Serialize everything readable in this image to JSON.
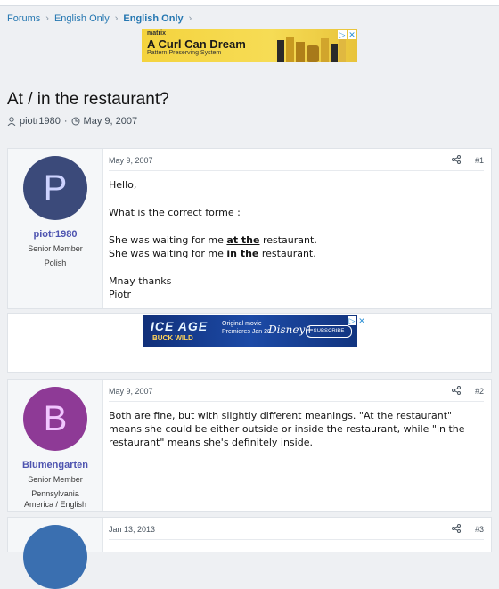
{
  "breadcrumb": {
    "items": [
      "Forums",
      "English Only",
      "English Only"
    ]
  },
  "ad_top": {
    "brand": "matrix",
    "headline": "A Curl Can Dream",
    "sub": "Pattern Preserving System"
  },
  "thread": {
    "title": "At / in the restaurant?",
    "author": "piotr1980",
    "date": "May 9, 2007"
  },
  "posts": [
    {
      "avatar_letter": "P",
      "avatar_color": "#3b4a7a",
      "username": "piotr1980",
      "role": "Senior Member",
      "location": "Polish",
      "date": "May 9, 2007",
      "number": "#1",
      "lines": {
        "l1": "Hello,",
        "l2": "What is the correct forme :",
        "l3a": "She was waiting for me ",
        "l3b": "at the",
        "l3c": " restaurant.",
        "l4a": "She was waiting for me ",
        "l4b": "in the",
        "l4c": " restaurant.",
        "l5": "Mnay thanks",
        "l6": "Piotr"
      }
    },
    {
      "avatar_letter": "B",
      "avatar_color": "#8e3a96",
      "username": "Blumengarten",
      "role": "Senior Member",
      "location1": "Pennsylvania",
      "location2": "America / English",
      "date": "May 9, 2007",
      "number": "#2",
      "text": "Both are fine, but with slightly different meanings. \"At the restaurant\" means she could be either outside or inside the restaurant, while \"in the restaurant\" means she's definitely inside."
    },
    {
      "date": "Jan 13, 2013",
      "number": "#3",
      "avatar_color": "#3a6fb0"
    }
  ],
  "ad_mid": {
    "big": "ICE AGE",
    "small": "BUCK WILD",
    "line1": "Original movie",
    "line2": "Premieres Jan 28",
    "brand": "Disney+",
    "button": "SUBSCRIBE"
  }
}
